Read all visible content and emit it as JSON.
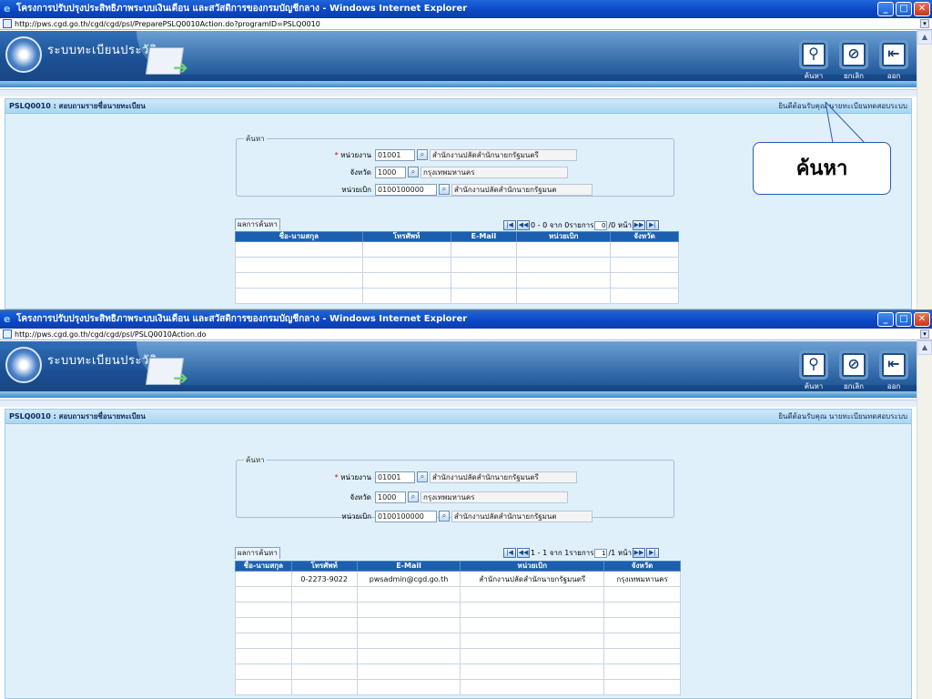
{
  "top_window": {
    "title": "โครงการปรับปรุงประสิทธิภาพระบบเงินเดือน และสวัสดิการของกรมบัญชีกลาง - Windows Internet Explorer",
    "url": "http://pws.cgd.go.th/cgd/cgd/psl/PreparePSLQ0010Action.do?programID=PSLQ0010",
    "app_name": "ระบบทะเบียนประวัติ",
    "toolbar": {
      "search": "ค้นหา",
      "cancel": "ยกเลิก",
      "exit": "ออก"
    },
    "panel_title": "PSLQ0010 : สอบถามรายชื่อนายทะเบียน",
    "welcome": "ยินดีต้อนรับคุณ นายทะเบียนทดสอบระบบ",
    "search_legend": "ค้นหา",
    "fields": {
      "unit_label": "หน่วยงาน",
      "unit_code": "01001",
      "unit_name": "สำนักงานปลัดสำนักนายกรัฐมนตรี",
      "province_label": "จังหวัด",
      "province_code": "1000",
      "province_name": "กรุงเทพมหานคร",
      "disb_label": "หน่วยเบิก",
      "disb_code": "0100100000",
      "disb_name": "สำนักงานปลัดสำนักนายกรัฐมนต"
    },
    "result_tab": "ผลการค้นหา",
    "pager": {
      "text1": "0 - 0 จาก 0รายการ",
      "page": "0",
      "text2": "/0 หน้า"
    },
    "columns": [
      "ชื่อ-นามสกุล",
      "โทรศัพท์",
      "E-Mail",
      "หน่วยเบิก",
      "จังหวัด"
    ],
    "callout": "ค้นหา"
  },
  "bottom_window": {
    "title": "โครงการปรับปรุงประสิทธิภาพระบบเงินเดือน และสวัสดิการของกรมบัญชีกลาง - Windows Internet Explorer",
    "url": "http://pws.cgd.go.th/cgd/cgd/psl/PSLQ0010Action.do",
    "app_name": "ระบบทะเบียนประวัติ",
    "toolbar": {
      "search": "ค้นหา",
      "cancel": "ยกเลิก",
      "exit": "ออก"
    },
    "panel_title": "PSLQ0010 : สอบถามรายชื่อนายทะเบียน",
    "welcome": "ยินดีต้อนรับคุณ นายทะเบียนทดสอบระบบ",
    "search_legend": "ค้นหา",
    "fields": {
      "unit_label": "หน่วยงาน",
      "unit_code": "01001",
      "unit_name": "สำนักงานปลัดสำนักนายกรัฐมนตรี",
      "province_label": "จังหวัด",
      "province_code": "1000",
      "province_name": "กรุงเทพมหานคร",
      "disb_label": "หน่วยเบิก",
      "disb_code": "0100100000",
      "disb_name": "สำนักงานปลัดสำนักนายกรัฐมนต"
    },
    "result_tab": "ผลการค้นหา",
    "pager": {
      "text1": "1 - 1 จาก 1รายการ",
      "page": "1",
      "text2": "/1 หน้า"
    },
    "columns": [
      "ชื่อ-นามสกุล",
      "โทรศัพท์",
      "E-Mail",
      "หน่วยเบิก",
      "จังหวัด"
    ],
    "rows": [
      {
        "name": "",
        "phone": "0-2273-9022",
        "email": "pwsadmin@cgd.go.th",
        "unit": "สำนักงานปลัดสำนักนายกรัฐมนตรี",
        "province": "กรุงเทพมหานคร"
      }
    ]
  }
}
